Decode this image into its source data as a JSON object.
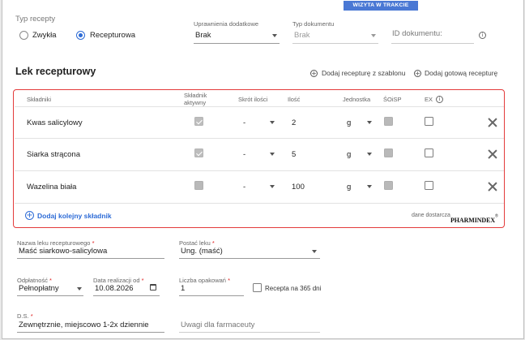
{
  "status_badge": "WIZYTA W TRAKCIE",
  "prescription_type": {
    "label": "Typ recepty",
    "options": [
      {
        "label": "Zwykła",
        "selected": false
      },
      {
        "label": "Recepturowa",
        "selected": true
      }
    ]
  },
  "extra_permissions": {
    "label": "Uprawnienia dodatkowe",
    "value": "Brak"
  },
  "document_type": {
    "label": "Typ dokumentu",
    "value": "Brak"
  },
  "document_id": {
    "placeholder": "ID dokumentu:"
  },
  "section": {
    "title": "Lek recepturowy",
    "add_from_template": "Dodaj recepturę z szablonu",
    "add_ready": "Dodaj gotową recepturę"
  },
  "table": {
    "headers": {
      "ingredients": "Składniki",
      "active_line1": "Składnik",
      "active_line2": "aktywny",
      "abbrev": "Skrót ilości",
      "quantity": "Ilość",
      "unit": "Jednostka",
      "soisp": "ŚOiSP",
      "ex": "EX"
    },
    "rows": [
      {
        "name": "Kwas salicylowy",
        "active": true,
        "abbrev": "-",
        "quantity": "2",
        "unit": "g"
      },
      {
        "name": "Siarka strącona",
        "active": true,
        "abbrev": "-",
        "quantity": "5",
        "unit": "g"
      },
      {
        "name": "Wazelina biała",
        "active": false,
        "abbrev": "-",
        "quantity": "100",
        "unit": "g"
      }
    ],
    "add_ingredient": "Dodaj kolejny składnik",
    "supplier_prefix": "dane dostarcza",
    "supplier_brand": "PHARMINDEX",
    "supplier_tm": "®"
  },
  "form": {
    "drug_name": {
      "label": "Nazwa leku recepturowego",
      "value": "Maść siarkowo-salicylowa"
    },
    "drug_form": {
      "label": "Postać leku",
      "value": "Ung. (maść)"
    },
    "payment": {
      "label": "Odpłatność",
      "value": "Pełnopłatny"
    },
    "date": {
      "label": "Data realizacji od",
      "value": "10.08.2026"
    },
    "packages": {
      "label": "Liczba opakowań",
      "value": "1"
    },
    "year_prescription": {
      "label": "Recepta na 365 dni",
      "checked": false
    },
    "ds": {
      "label": "D.S.",
      "value": "Zewnętrznie, miejscowo 1-2x dziennie"
    },
    "pharmacist_notes": {
      "placeholder": "Uwagi dla farmaceuty"
    }
  },
  "colors": {
    "accent": "#2d6bd6",
    "badge": "#4a78d4",
    "highlight_border": "#e33b3b"
  }
}
